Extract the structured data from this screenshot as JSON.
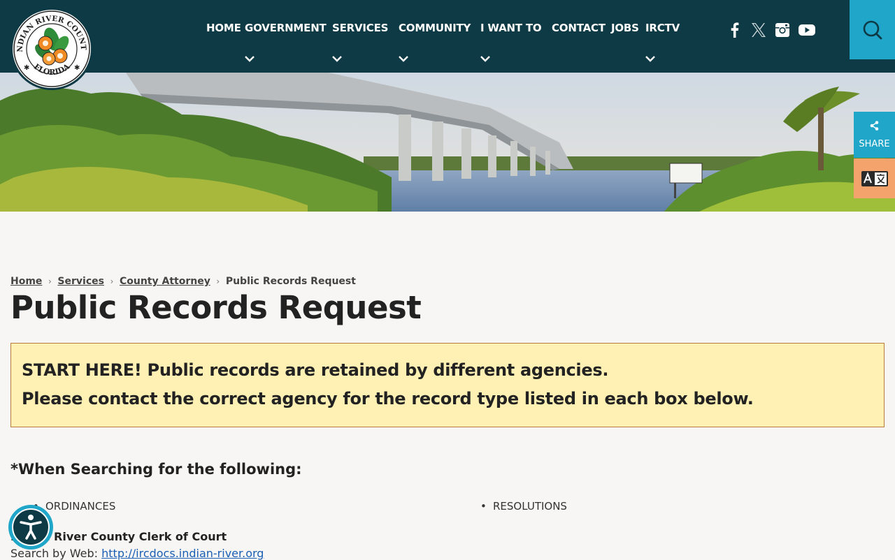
{
  "header": {
    "logo_text_top": "INDIAN RIVER COUNTY",
    "logo_text_bottom": "FLORIDA",
    "nav": [
      {
        "label": "HOME",
        "has_dropdown": false
      },
      {
        "label": "GOVERNMENT",
        "has_dropdown": true
      },
      {
        "label": "SERVICES",
        "has_dropdown": true
      },
      {
        "label": "COMMUNITY",
        "has_dropdown": true
      },
      {
        "label": "I WANT TO",
        "has_dropdown": true
      },
      {
        "label": "CONTACT",
        "has_dropdown": false
      },
      {
        "label": "JOBS",
        "has_dropdown": false
      },
      {
        "label": "IRCTV",
        "has_dropdown": true
      }
    ],
    "social": [
      "facebook-icon",
      "x-twitter-icon",
      "instagram-icon",
      "youtube-icon"
    ]
  },
  "side_tools": {
    "share_label": "SHARE"
  },
  "breadcrumb": {
    "items": [
      "Home",
      "Services",
      "County Attorney"
    ],
    "current": "Public Records Request"
  },
  "page": {
    "title": "Public Records Request",
    "notice_line1": "START HERE! Public records are retained by different agencies.",
    "notice_line2": "Please contact the correct agency for the record type listed in each box below.",
    "subheading": "*When Searching for the following:",
    "bullets": [
      "ORDINANCES",
      "RESOLUTIONS"
    ],
    "agency": "Indian River County Clerk of Court",
    "search_label": "Search by Web: ",
    "search_link": "http://ircdocs.indian-river.org"
  },
  "colors": {
    "header_bg": "#0d3a44",
    "accent": "#1fa6c9",
    "notice_bg": "#fff0b3",
    "translate_bg": "#f3a36b"
  }
}
